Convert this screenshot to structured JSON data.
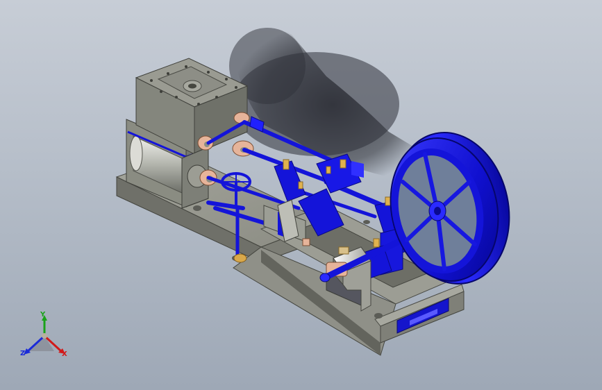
{
  "viewport": {
    "background_top": "#c7cdd6",
    "background_bottom": "#9ea8b6"
  },
  "model": {
    "base_color": "#8a8c82",
    "part_color": "#1414d9",
    "highlight_color": "#2424ff",
    "brass_color": "#d9a84a",
    "copper_color": "#c98a66"
  },
  "triad": {
    "x_label": "X",
    "y_label": "Y",
    "z_label": "Z",
    "x_color": "#d11a1a",
    "y_color": "#1aa21a",
    "z_color": "#1b2bd8"
  }
}
